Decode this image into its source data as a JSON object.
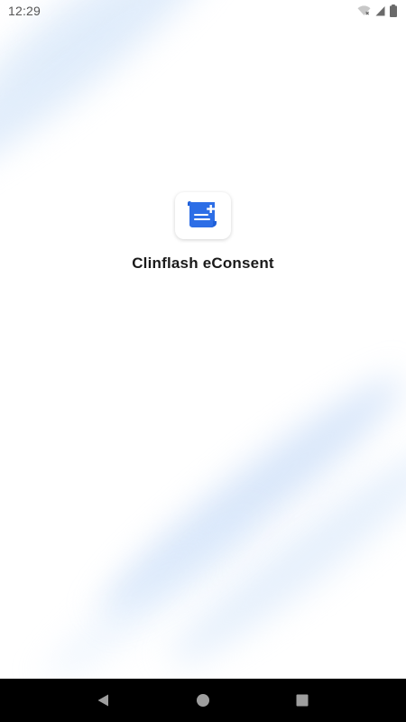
{
  "status_bar": {
    "time": "12:29",
    "icons": [
      "wifi-off-icon",
      "cellular-signal-icon",
      "battery-icon"
    ]
  },
  "splash": {
    "app_name": "Clinflash eConsent",
    "icon": "document-scroll-plus-icon"
  },
  "navigation_bar": {
    "buttons": [
      "back-triangle-icon",
      "home-circle-icon",
      "recents-square-icon"
    ]
  },
  "colors": {
    "background": "#ffffff",
    "accent_blue": "#2d6ee6",
    "nav_bar": "#000000",
    "nav_icon": "#9e9e9e",
    "status_text": "#555555"
  }
}
